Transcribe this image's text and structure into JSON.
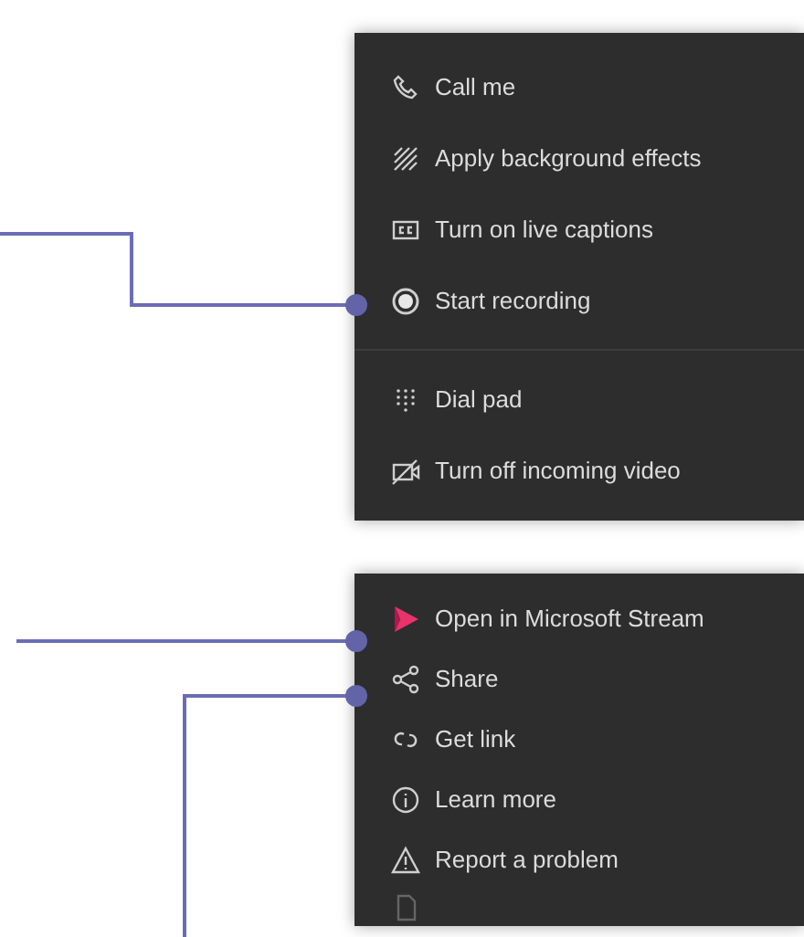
{
  "menus": [
    {
      "groups": [
        [
          {
            "label": "Call me",
            "kind": "phone"
          },
          {
            "label": "Apply background effects",
            "kind": "effects"
          },
          {
            "label": "Turn on live captions",
            "kind": "captions"
          },
          {
            "label": "Start recording",
            "kind": "record"
          }
        ],
        [
          {
            "label": "Dial pad",
            "kind": "dialpad"
          },
          {
            "label": "Turn off incoming video",
            "kind": "video-off"
          }
        ]
      ]
    },
    {
      "groups": [
        [
          {
            "label": "Open in Microsoft Stream",
            "kind": "stream"
          },
          {
            "label": "Share",
            "kind": "share"
          },
          {
            "label": "Get link",
            "kind": "link"
          },
          {
            "label": "Learn more",
            "kind": "info"
          },
          {
            "label": "Report a problem",
            "kind": "warning"
          }
        ]
      ]
    }
  ]
}
